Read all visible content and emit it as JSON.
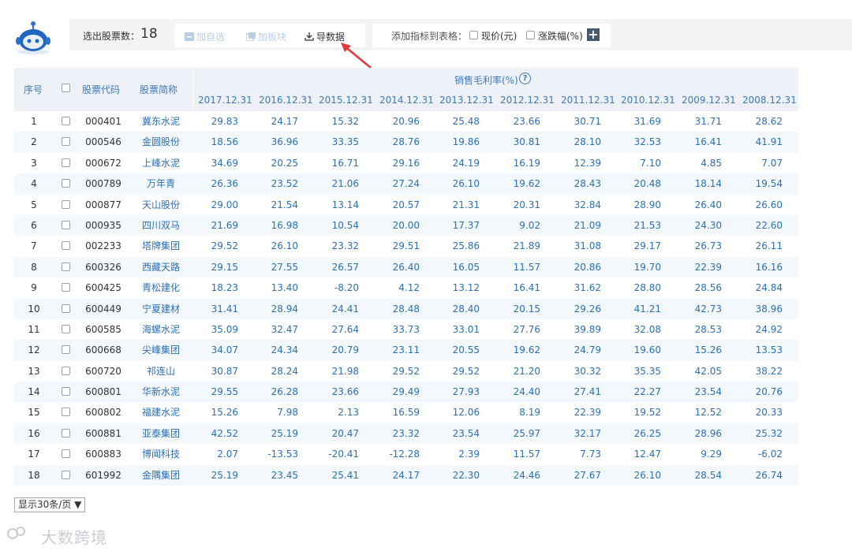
{
  "header": {
    "stat_label": "选出股票数：",
    "stat_count": "18",
    "buttons": {
      "add_watchlist": "加自选",
      "add_sector": "加板块",
      "export": "导数据"
    },
    "indicator_label": "添加指标到表格：",
    "indicators": [
      "现价(元)",
      "涨跌幅(%)"
    ],
    "plus": "+"
  },
  "table": {
    "col_index": "序号",
    "col_code": "股票代码",
    "col_name": "股票简称",
    "metric_title": "销售毛利率(%)",
    "help": "?",
    "years": [
      "2017.12.31",
      "2016.12.31",
      "2015.12.31",
      "2014.12.31",
      "2013.12.31",
      "2012.12.31",
      "2011.12.31",
      "2010.12.31",
      "2009.12.31",
      "2008.12.31"
    ],
    "rows": [
      {
        "idx": "1",
        "code": "000401",
        "name": "冀东水泥",
        "values": [
          "29.83",
          "24.17",
          "15.32",
          "20.96",
          "25.48",
          "23.66",
          "30.71",
          "31.69",
          "31.71",
          "28.62"
        ]
      },
      {
        "idx": "2",
        "code": "000546",
        "name": "金圆股份",
        "values": [
          "18.56",
          "36.96",
          "33.35",
          "28.76",
          "19.86",
          "30.81",
          "28.10",
          "32.53",
          "16.41",
          "41.91"
        ]
      },
      {
        "idx": "3",
        "code": "000672",
        "name": "上峰水泥",
        "values": [
          "34.69",
          "20.25",
          "16.71",
          "29.16",
          "24.19",
          "16.19",
          "12.39",
          "7.10",
          "4.85",
          "7.07"
        ]
      },
      {
        "idx": "4",
        "code": "000789",
        "name": "万年青",
        "values": [
          "26.36",
          "23.52",
          "21.06",
          "27.24",
          "26.10",
          "19.62",
          "28.43",
          "20.48",
          "18.14",
          "19.54"
        ]
      },
      {
        "idx": "5",
        "code": "000877",
        "name": "天山股份",
        "values": [
          "29.00",
          "21.54",
          "13.14",
          "20.57",
          "21.31",
          "20.31",
          "32.84",
          "28.90",
          "26.40",
          "26.60"
        ]
      },
      {
        "idx": "6",
        "code": "000935",
        "name": "四川双马",
        "values": [
          "21.69",
          "16.98",
          "10.54",
          "20.00",
          "17.37",
          "9.02",
          "21.09",
          "21.53",
          "24.30",
          "22.60"
        ]
      },
      {
        "idx": "7",
        "code": "002233",
        "name": "塔牌集团",
        "values": [
          "29.52",
          "26.10",
          "23.32",
          "29.51",
          "25.86",
          "21.89",
          "31.08",
          "29.17",
          "26.73",
          "26.11"
        ]
      },
      {
        "idx": "8",
        "code": "600326",
        "name": "西藏天路",
        "values": [
          "29.15",
          "27.55",
          "26.57",
          "26.40",
          "16.05",
          "11.57",
          "20.86",
          "19.70",
          "22.39",
          "16.16"
        ]
      },
      {
        "idx": "9",
        "code": "600425",
        "name": "青松建化",
        "values": [
          "18.23",
          "13.40",
          "-8.20",
          "4.12",
          "13.12",
          "16.41",
          "31.62",
          "28.80",
          "28.56",
          "24.84"
        ]
      },
      {
        "idx": "10",
        "code": "600449",
        "name": "宁夏建材",
        "values": [
          "31.41",
          "28.94",
          "24.41",
          "28.48",
          "28.40",
          "20.15",
          "29.26",
          "41.21",
          "42.73",
          "38.96"
        ]
      },
      {
        "idx": "11",
        "code": "600585",
        "name": "海螺水泥",
        "values": [
          "35.09",
          "32.47",
          "27.64",
          "33.73",
          "33.01",
          "27.76",
          "39.89",
          "32.08",
          "28.53",
          "24.92"
        ]
      },
      {
        "idx": "12",
        "code": "600668",
        "name": "尖峰集团",
        "values": [
          "34.07",
          "24.34",
          "20.79",
          "23.11",
          "20.55",
          "19.62",
          "24.79",
          "19.60",
          "15.26",
          "13.53"
        ]
      },
      {
        "idx": "13",
        "code": "600720",
        "name": "祁连山",
        "values": [
          "30.87",
          "28.24",
          "21.98",
          "29.52",
          "29.52",
          "21.20",
          "30.32",
          "35.35",
          "42.05",
          "38.22"
        ]
      },
      {
        "idx": "14",
        "code": "600801",
        "name": "华新水泥",
        "values": [
          "29.55",
          "26.28",
          "23.66",
          "29.49",
          "27.93",
          "24.40",
          "27.41",
          "22.27",
          "23.54",
          "20.76"
        ]
      },
      {
        "idx": "15",
        "code": "600802",
        "name": "福建水泥",
        "values": [
          "15.26",
          "7.98",
          "2.13",
          "16.59",
          "12.06",
          "8.19",
          "22.39",
          "19.52",
          "12.52",
          "20.33"
        ]
      },
      {
        "idx": "16",
        "code": "600881",
        "name": "亚泰集团",
        "values": [
          "42.52",
          "25.19",
          "20.47",
          "23.32",
          "23.54",
          "25.97",
          "32.17",
          "26.25",
          "28.96",
          "25.32"
        ]
      },
      {
        "idx": "17",
        "code": "600883",
        "name": "博闻科技",
        "values": [
          "2.07",
          "-13.53",
          "-20.41",
          "-12.28",
          "2.39",
          "11.57",
          "7.73",
          "12.47",
          "9.29",
          "-6.02"
        ]
      },
      {
        "idx": "18",
        "code": "601992",
        "name": "金隅集团",
        "values": [
          "25.19",
          "23.45",
          "25.41",
          "24.17",
          "22.30",
          "24.46",
          "27.67",
          "26.10",
          "28.54",
          "26.74"
        ]
      }
    ]
  },
  "pager": {
    "label": "显示30条/页 ▼"
  },
  "watermark": "大数跨境",
  "colors": {
    "header_bg": "#eef2f8",
    "alt_row": "#f2f8fc",
    "link_blue": "#2d6fb5",
    "arrow_red": "#e53935"
  }
}
